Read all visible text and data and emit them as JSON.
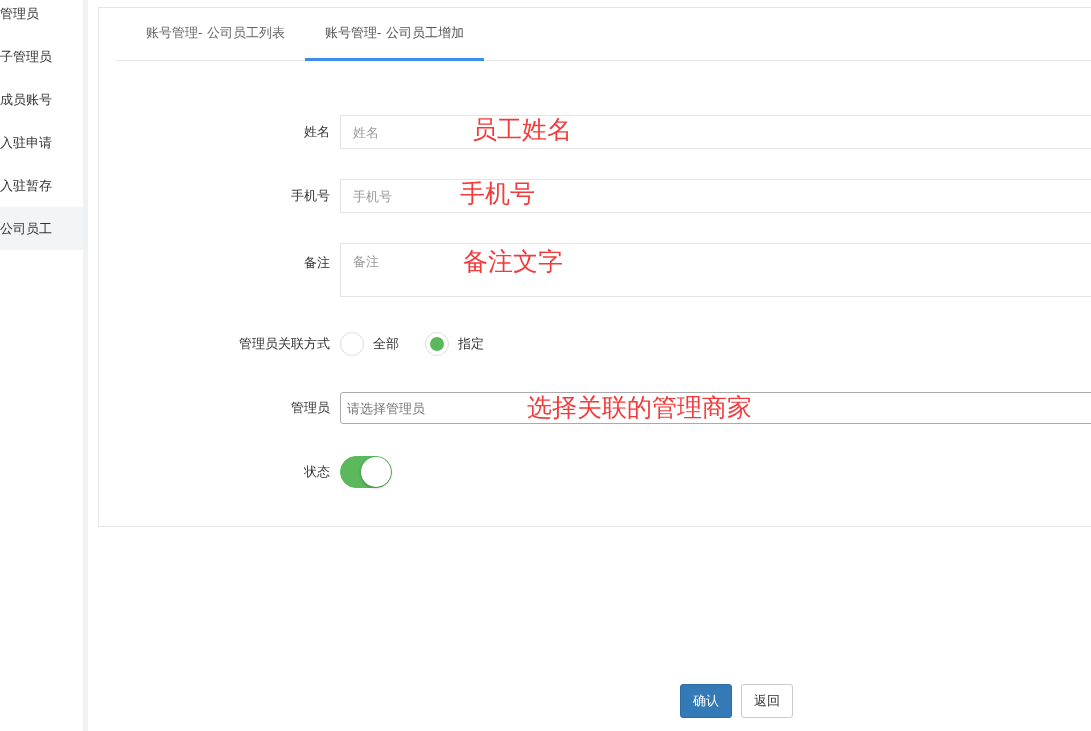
{
  "sidebar": {
    "items": [
      {
        "label": "管理员",
        "selected": false
      },
      {
        "label": "子管理员",
        "selected": false
      },
      {
        "label": "成员账号",
        "selected": false
      },
      {
        "label": "入驻申请",
        "selected": false
      },
      {
        "label": "入驻暂存",
        "selected": false
      },
      {
        "label": "公司员工",
        "selected": true
      }
    ]
  },
  "tabs": [
    {
      "label": "账号管理- 公司员工列表",
      "selected": false
    },
    {
      "label": "账号管理- 公司员工增加",
      "selected": true
    }
  ],
  "form": {
    "fields": [
      {
        "kind": "text",
        "label": "姓名",
        "placeholder": "姓名",
        "annotation": "员工姓名"
      },
      {
        "kind": "text",
        "label": "手机号",
        "placeholder": "手机号",
        "annotation": "手机号"
      },
      {
        "kind": "textarea",
        "label": "备注",
        "placeholder": "备注",
        "annotation": "备注文字"
      },
      {
        "kind": "radio",
        "label": "管理员关联方式",
        "options": [
          {
            "label": "全部",
            "selected": false
          },
          {
            "label": "指定",
            "selected": true
          }
        ]
      },
      {
        "kind": "select",
        "label": "管理员",
        "placeholder": "请选择管理员",
        "annotation": "选择关联的管理商家"
      },
      {
        "kind": "toggle",
        "label": "状态",
        "on": true
      }
    ]
  },
  "buttons": [
    {
      "label": "确认",
      "kind": "primary"
    },
    {
      "label": "返回",
      "kind": "default"
    }
  ]
}
